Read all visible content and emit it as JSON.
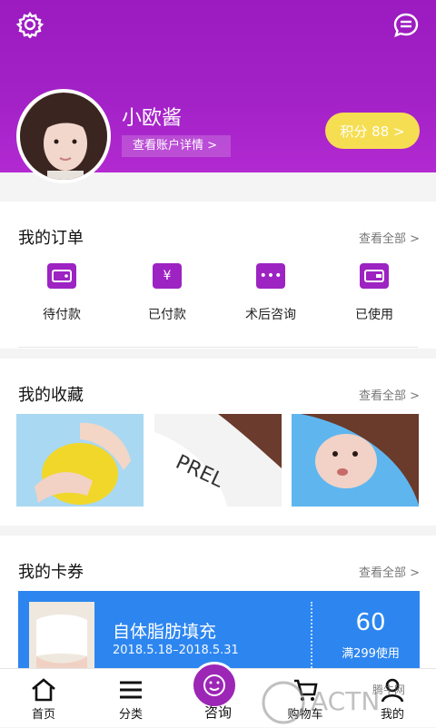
{
  "header": {
    "username": "小欧酱",
    "account_link": "查看账户详情 >",
    "points_label": "积分 88 >"
  },
  "orders": {
    "title": "我的订单",
    "see_all": "查看全部 >",
    "items": [
      {
        "label": "待付款",
        "icon": "wallet-icon"
      },
      {
        "label": "已付款",
        "icon": "yuan-icon"
      },
      {
        "label": "术后咨询",
        "icon": "chat-dots-icon"
      },
      {
        "label": "已使用",
        "icon": "wallet-used-icon"
      }
    ]
  },
  "favorites": {
    "title": "我的收藏",
    "see_all": "查看全部 >"
  },
  "coupons": {
    "title": "我的卡券",
    "see_all": "查看全部 >",
    "item": {
      "name": "自体脂肪填充",
      "dates": "2018.5.18–2018.5.31",
      "amount": "60",
      "condition": "满299使用"
    }
  },
  "tabs": [
    {
      "label": "首页"
    },
    {
      "label": "分类"
    },
    {
      "label": "咨询"
    },
    {
      "label": "购物车"
    },
    {
      "label": "我的"
    }
  ],
  "colors": {
    "brand_purple": "#9b1bc0",
    "points_yellow": "#f6de52",
    "coupon_blue": "#2d86f0"
  }
}
